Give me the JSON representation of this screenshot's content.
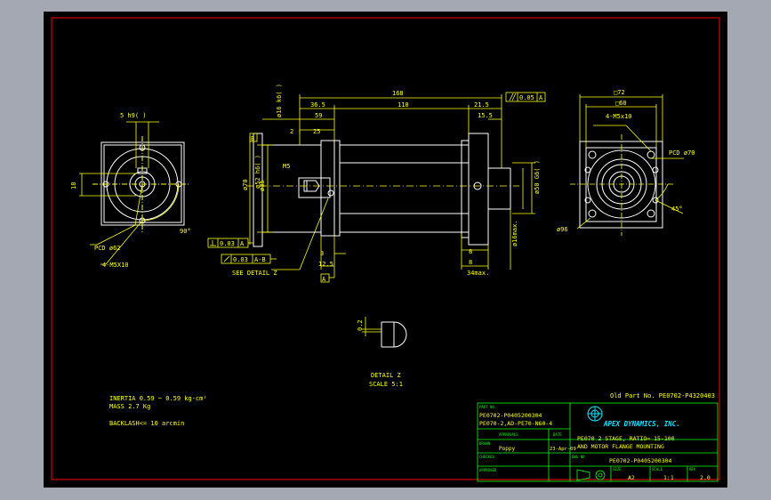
{
  "dimensions": {
    "total_length": "168",
    "len_110": "110",
    "len_36_5": "36.5",
    "len_59": "59",
    "len_21_5": "21.5",
    "len_15_5": "15.5",
    "len_25": "25",
    "len_2": "2",
    "len_3": "3",
    "len_12_5": "12.5",
    "len_8_upper": "8",
    "len_8_lower": "8",
    "len_34max": "34max.",
    "dia_16_k6": "ø16 k6(  )",
    "dia_70": "ø70",
    "dia_52_h6": "ø52 h6(  )",
    "dia_35": "ø35",
    "dia_50_g6": "ø50 G6(  )",
    "dia_16max": "ø16max.",
    "dia_96": "ø96",
    "key_5h9": "5 h9(  )",
    "dim_18": "18",
    "sq_72": "□72",
    "sq_60": "□60",
    "holes_4m5x10_top": "4-M5x10",
    "holes_4m5x10_left": "4-M5X10",
    "pcd_70": "PCD ø70",
    "pcd_62": "PCD ø62",
    "angle_45": "45°",
    "angle_90": "90°",
    "thread_m5": "M5",
    "detail_dim": "0.2",
    "parallel_tol": "0.05",
    "datum_a_top": "A",
    "datum_a_bottom": "A",
    "datum_b": "B",
    "runout_a": "0.03",
    "runout_a_datum": "A",
    "runout_ab": "0.03",
    "runout_ab_datum": "A-B"
  },
  "labels": {
    "see_detail": "SEE DETAIL Z",
    "detail_title": "DETAIL Z",
    "detail_scale": "SCALE 5:1"
  },
  "notes": {
    "inertia": "INERTIA 0.59 ~ 0.59 kg-cm²",
    "mass": "MASS 2.7 Kg",
    "backlash": "BACKLASH<= 10 arcmin"
  },
  "title_block": {
    "old_part": "Old Part No. PE0702-P4320403",
    "part_no_label": "PART NO.",
    "part_no_1": "PE0702-P0405200304",
    "part_no_2": "PE070-2,AD-PE70-N60-4",
    "approvals_label": "APPROVALS",
    "date_label": "DATE",
    "drawn_label": "DRAWN",
    "drawn_by": "Poppy",
    "drawn_date": "23-Apr-09",
    "checked_label": "CHECKED",
    "approved_label": "APPROVED",
    "company": "APEX DYNAMICS, INC.",
    "description_1": "PE070 2 STAGE, RATIO= 15-100",
    "description_2": "AND MOTOR FLANGE MOUNTING",
    "dwg_no_label": "DWG NO",
    "dwg_no": "PE0702-P0405200304",
    "size_label": "SIZE",
    "scale_label": "SCALE",
    "rev_label": "REV",
    "size": "A2",
    "scale": "1:1",
    "rev": "2.0"
  },
  "colors": {
    "background": "#000000",
    "frame": "#ff0000",
    "geometry": "#ffffff",
    "dimensions": "#ffff00",
    "title_block": "#00ff00",
    "logo": "#00e5ff"
  }
}
